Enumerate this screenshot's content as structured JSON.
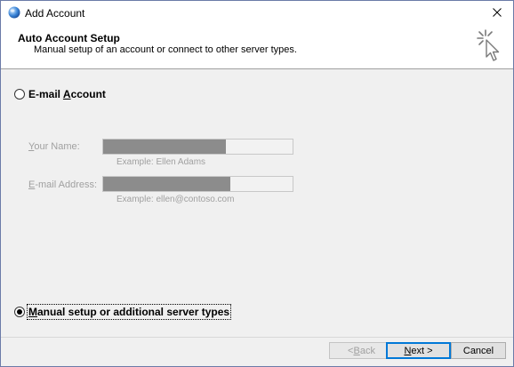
{
  "window": {
    "title": "Add Account",
    "icon": "outlook-globe-icon"
  },
  "header": {
    "title": "Auto Account Setup",
    "subtitle": "Manual setup of an account or connect to other server types."
  },
  "options": {
    "email_account": {
      "pre": "E-mail ",
      "accel": "A",
      "post": "ccount",
      "selected": false
    },
    "manual_setup": {
      "accel": "M",
      "post": "anual setup or additional server types",
      "selected": true
    }
  },
  "fields": {
    "name": {
      "label_accel": "Y",
      "label_rest": "our Name:",
      "hint": "Example: Ellen Adams",
      "fill_fraction": 0.65
    },
    "email": {
      "label_accel": "E",
      "label_rest": "-mail Address:",
      "hint": "Example: ellen@contoso.com",
      "fill_fraction": 0.67
    }
  },
  "buttons": {
    "back": {
      "pre": "< ",
      "accel": "B",
      "post": "ack",
      "enabled": false
    },
    "next": {
      "accel": "N",
      "post": "ext >",
      "enabled": true
    },
    "cancel": {
      "label": "Cancel",
      "enabled": true
    }
  },
  "colors": {
    "disabled_text": "#a0a0a0",
    "masked_fill": "#8c8c8c",
    "default_button_border": "#0078d7"
  }
}
